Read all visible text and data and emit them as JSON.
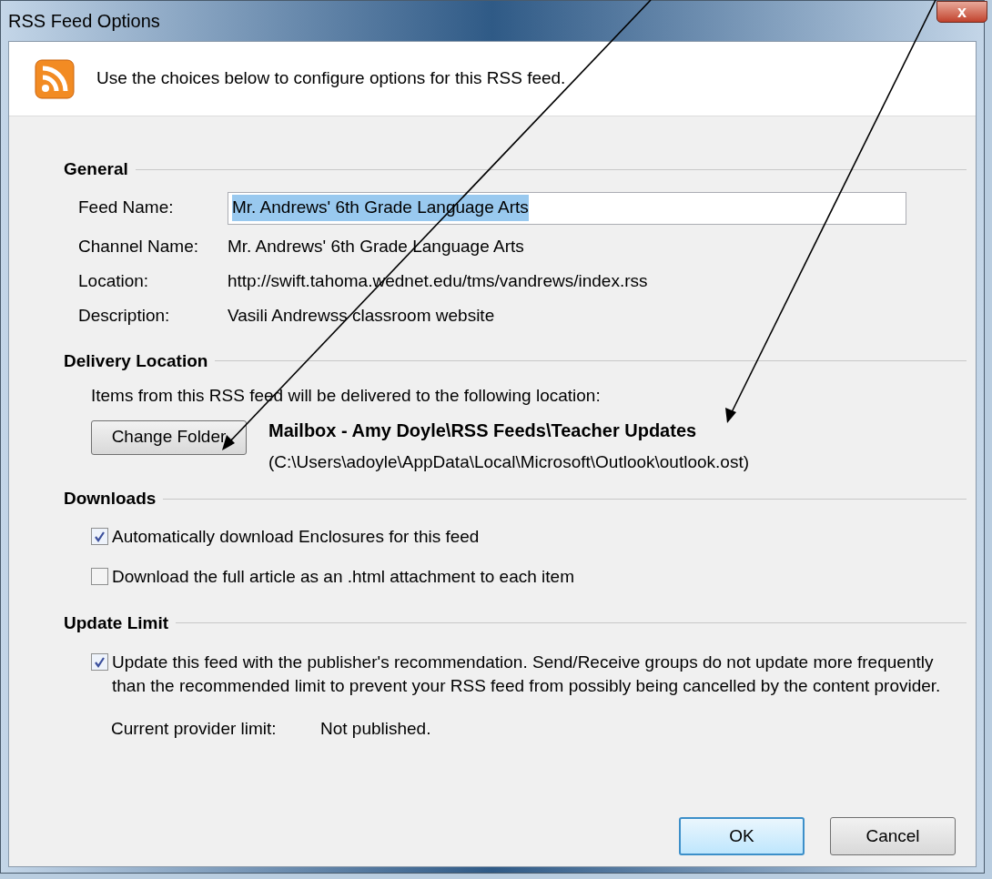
{
  "window": {
    "title": "RSS Feed Options",
    "close_label": "x"
  },
  "header": {
    "text": "Use the choices below to configure options for this RSS feed."
  },
  "general": {
    "heading": "General",
    "feed_name": {
      "label": "Feed Name:",
      "value": "Mr. Andrews' 6th Grade Language Arts",
      "selected": true
    },
    "rows": [
      {
        "label": "Channel Name:",
        "value": "Mr. Andrews' 6th Grade Language Arts"
      },
      {
        "label": "Location:",
        "value": "http://swift.tahoma.wednet.edu/tms/vandrews/index.rss"
      },
      {
        "label": "Description:",
        "value": "Vasili Andrewss classroom website"
      }
    ]
  },
  "delivery": {
    "heading": "Delivery Location",
    "intro": "Items from this RSS feed will be delivered to the following location:",
    "button": "Change Folder",
    "folder": "Mailbox - Amy Doyle\\RSS Feeds\\Teacher Updates",
    "path": "(C:\\Users\\adoyle\\AppData\\Local\\Microsoft\\Outlook\\outlook.ost)"
  },
  "downloads": {
    "heading": "Downloads",
    "options": [
      {
        "label": "Automatically download Enclosures for this feed",
        "checked": true
      },
      {
        "label": "Download the full article as an .html attachment to each item",
        "checked": false
      }
    ]
  },
  "update_limit": {
    "heading": "Update Limit",
    "option": {
      "label": "Update this feed with the publisher's recommendation. Send/Receive groups do not update more frequently than the recommended limit to prevent your RSS feed from possibly being cancelled by the content provider.",
      "checked": true
    },
    "limit_label": "Current provider limit:",
    "limit_value": "Not published."
  },
  "buttons": [
    {
      "label": "OK",
      "default": true
    },
    {
      "label": "Cancel",
      "default": false
    }
  ]
}
